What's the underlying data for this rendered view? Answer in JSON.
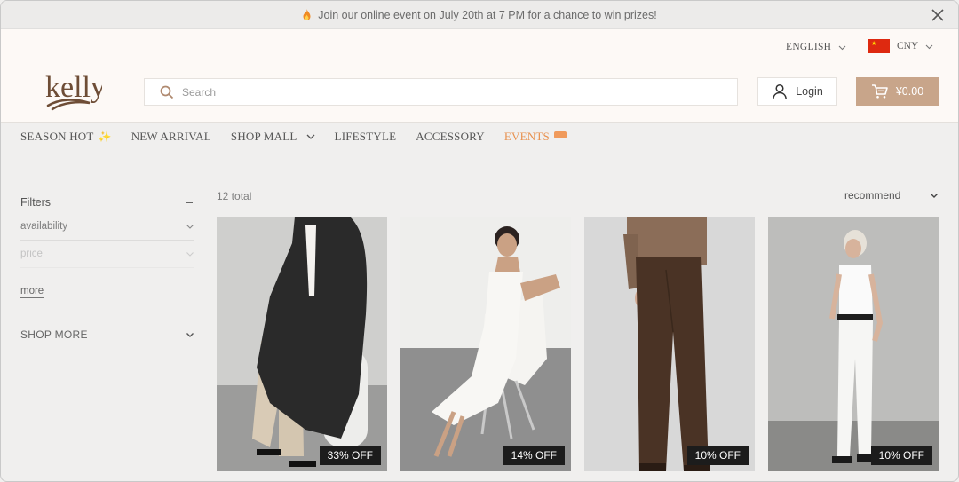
{
  "announcement": {
    "text": "Join our online event on July 20th at 7 PM for a chance to win prizes!"
  },
  "header": {
    "language": "ENGLISH",
    "currency": "CNY",
    "logo_text": "kelly",
    "search_placeholder": "Search",
    "login_label": "Login",
    "cart_total": "¥0.00"
  },
  "nav": {
    "items": [
      {
        "label": "SEASON HOT"
      },
      {
        "label": "NEW ARRIVAL"
      },
      {
        "label": "SHOP MALL"
      },
      {
        "label": "LIFESTYLE"
      },
      {
        "label": "ACCESSORY"
      },
      {
        "label": "EVENTS"
      }
    ]
  },
  "sidebar": {
    "filters_label": "Filters",
    "filters": [
      {
        "label": "availability"
      },
      {
        "label": "price"
      }
    ],
    "more_label": "more",
    "shop_more_label": "SHOP MORE"
  },
  "results": {
    "total": "12 total",
    "sort_label": "recommend",
    "products": [
      {
        "discount": "33% OFF"
      },
      {
        "discount": "14% OFF"
      },
      {
        "discount": "10% OFF"
      },
      {
        "discount": "10% OFF"
      }
    ]
  },
  "colors": {
    "accent": "#c8a58a",
    "events": "#e8914f",
    "badge_bg": "#1c1c1c"
  }
}
